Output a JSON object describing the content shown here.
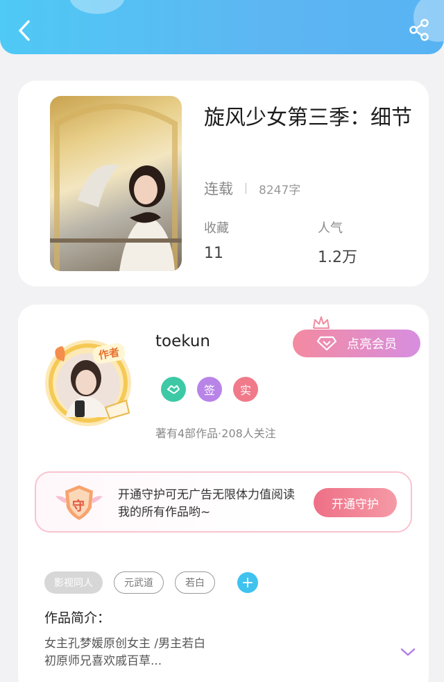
{
  "header": {
    "back_icon": "chevron-left-icon",
    "share_icon": "share-icon",
    "gradient": [
      "#4fc9f5",
      "#58b3f3"
    ]
  },
  "book": {
    "title": "旋风少女第三季：细节",
    "status": "连载",
    "word_count": "8247字",
    "favorites_label": "收藏",
    "favorites_value": "11",
    "popularity_label": "人气",
    "popularity_value": "1.2万"
  },
  "author": {
    "name": "toekun",
    "badge_text": "作者",
    "vip_button_label": "点亮会员",
    "badges": [
      {
        "icon": "handshake-icon",
        "color": "#3dc9a6"
      },
      {
        "label": "签",
        "color": "#b884e8"
      },
      {
        "label": "实",
        "color": "#f07a8a"
      }
    ],
    "works_info": "著有4部作品·208人关注"
  },
  "guard": {
    "icon_label": "守",
    "text": "开通守护可无广告无限体力值阅读我的所有作品哟~",
    "button_label": "开通守护"
  },
  "tags": {
    "items": [
      "影视同人",
      "元武道",
      "若白"
    ],
    "add_icon": "plus-icon",
    "accent": "#3fc2ee"
  },
  "intro": {
    "title": "作品简介：",
    "line1": "女主孔梦媛原创女主 /男主若白",
    "line2": "初原师兄喜欢戚百草...",
    "expand_icon": "chevron-down-icon"
  }
}
